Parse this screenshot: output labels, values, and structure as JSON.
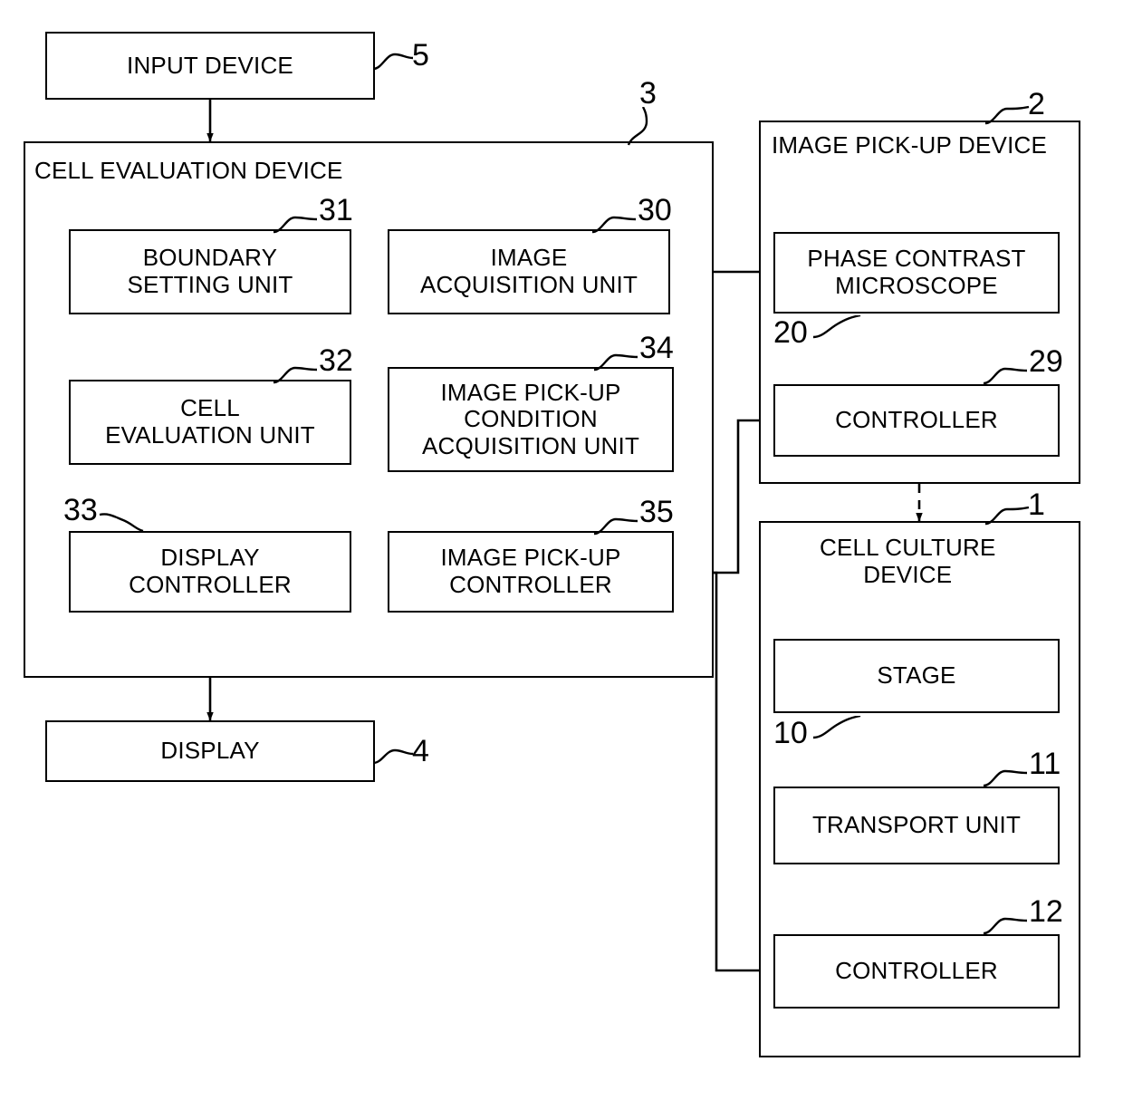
{
  "figure": {
    "type": "patent-block-diagram",
    "background": "#ffffff",
    "line_color": "#000000"
  },
  "blocks": {
    "input_device": {
      "label": "INPUT DEVICE",
      "ref": "5"
    },
    "cell_evaluation_device": {
      "label": "CELL EVALUATION DEVICE",
      "ref": "3"
    },
    "boundary_setting_unit": {
      "label": "BOUNDARY\nSETTING UNIT",
      "ref": "31"
    },
    "image_acquisition_unit": {
      "label": "IMAGE\nACQUISITION UNIT",
      "ref": "30"
    },
    "cell_evaluation_unit": {
      "label": "CELL\nEVALUATION UNIT",
      "ref": "32"
    },
    "image_pickup_condition_acquisition_unit": {
      "label": "IMAGE PICK-UP\nCONDITION\nACQUISITION UNIT",
      "ref": "34"
    },
    "display_controller": {
      "label": "DISPLAY\nCONTROLLER",
      "ref": "33"
    },
    "image_pickup_controller": {
      "label": "IMAGE PICK-UP\nCONTROLLER",
      "ref": "35"
    },
    "display": {
      "label": "DISPLAY",
      "ref": "4"
    },
    "image_pickup_device": {
      "label": "IMAGE PICK-UP DEVICE",
      "ref": "2"
    },
    "phase_contrast_microscope": {
      "label": "PHASE CONTRAST\nMICROSCOPE",
      "ref": "20"
    },
    "pickup_controller": {
      "label": "CONTROLLER",
      "ref": "29"
    },
    "cell_culture_device": {
      "label": "CELL CULTURE\nDEVICE",
      "ref": "1"
    },
    "stage": {
      "label": "STAGE",
      "ref": "10"
    },
    "transport_unit": {
      "label": "TRANSPORT UNIT",
      "ref": "11"
    },
    "culture_controller": {
      "label": "CONTROLLER",
      "ref": "12"
    }
  },
  "connections": [
    {
      "name": "input-device-to-cell-evaluation-device",
      "style": "solid-arrow"
    },
    {
      "name": "image-acquisition-to-boundary-setting",
      "style": "solid-arrow"
    },
    {
      "name": "boundary-setting-to-cell-evaluation-unit",
      "style": "solid-arrow"
    },
    {
      "name": "cell-evaluation-unit-to-display-controller",
      "style": "solid-arrow"
    },
    {
      "name": "cell-evaluation-unit-to-pickup-condition-acquisition",
      "style": "solid-arrow"
    },
    {
      "name": "pickup-condition-acquisition-to-pickup-controller",
      "style": "solid-arrow"
    },
    {
      "name": "display-controller-to-display",
      "style": "solid-arrow"
    },
    {
      "name": "phase-contrast-microscope-to-image-acquisition",
      "style": "solid-arrow"
    },
    {
      "name": "image-pickup-controller-to-pickup-device-controller",
      "style": "solid-arrow"
    },
    {
      "name": "image-pickup-controller-to-culture-device-controller",
      "style": "solid-arrow"
    },
    {
      "name": "image-pickup-device-to-cell-culture-device",
      "style": "dashed-arrow"
    }
  ]
}
